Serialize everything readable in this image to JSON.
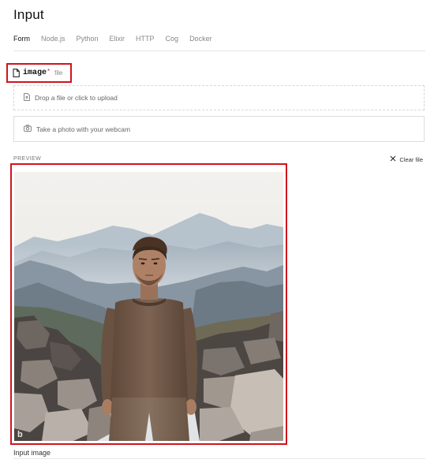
{
  "page": {
    "title": "Input"
  },
  "tabs": [
    {
      "label": "Form",
      "active": true
    },
    {
      "label": "Node.js",
      "active": false
    },
    {
      "label": "Python",
      "active": false
    },
    {
      "label": "Elixir",
      "active": false
    },
    {
      "label": "HTTP",
      "active": false
    },
    {
      "label": "Cog",
      "active": false
    },
    {
      "label": "Docker",
      "active": false
    }
  ],
  "field": {
    "name": "image",
    "required_mark": "*",
    "type": "file",
    "icon": "file-icon"
  },
  "upload": {
    "dropzone_label": "Drop a file or click to upload",
    "dropzone_icon": "upload-file-icon",
    "webcam_label": "Take a photo with your webcam",
    "webcam_icon": "camera-icon"
  },
  "preview": {
    "label": "PREVIEW",
    "clear_label": "Clear file",
    "clear_icon": "close-icon",
    "caption": "Input image",
    "watermark": "b"
  },
  "colors": {
    "highlight": "#d0141e",
    "muted_text": "#888888"
  }
}
